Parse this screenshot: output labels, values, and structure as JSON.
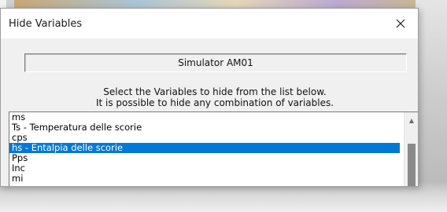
{
  "dialog": {
    "title": "Hide Variables",
    "close_label": "×"
  },
  "simulator_label": "Simulator AM01",
  "instructions": {
    "line1": "Select the Variables to hide from the list below.",
    "line2": "It is possible to hide any combination of variables."
  },
  "variables_list": {
    "selected_index": 3,
    "items": [
      "ms",
      "Ts - Temperatura delle scorie",
      "cps",
      "hs - Entalpia delle scorie",
      "Pps",
      "Inc",
      "mi"
    ]
  },
  "colors": {
    "selection": "#0078d7",
    "dialog_bg": "#f0f0f0"
  },
  "icons": {
    "close": "close-icon",
    "scroll_up": "chevron-up-icon"
  }
}
